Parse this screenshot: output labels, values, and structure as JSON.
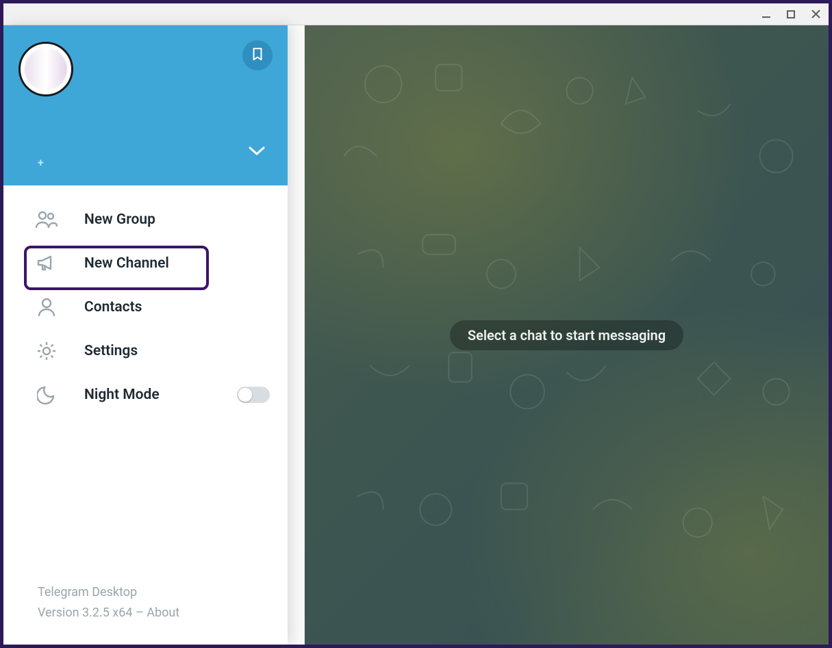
{
  "window": {
    "minimize_title": "Minimize",
    "maximize_title": "Maximize",
    "close_title": "Close"
  },
  "header": {
    "bookmark_title": "Saved Messages",
    "expand_title": "Expand account list",
    "plus_indicator": "+"
  },
  "menu": {
    "new_group": "New Group",
    "new_channel": "New Channel",
    "contacts": "Contacts",
    "settings": "Settings",
    "night_mode": "Night Mode"
  },
  "night_mode_on": false,
  "footer": {
    "app_name": "Telegram Desktop",
    "version_line": "Version 3.2.5 x64 – About"
  },
  "main": {
    "empty_hint": "Select a chat to start messaging"
  },
  "highlight": "new_channel",
  "colors": {
    "accent": "#3fa7d7",
    "accent_dark": "#2f8fbf",
    "text": "#1f2a33",
    "muted": "#9aa5ac",
    "outer": "#2e1a5a",
    "highlight": "#3a1569"
  }
}
